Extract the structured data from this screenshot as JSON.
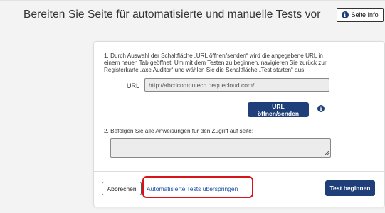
{
  "page": {
    "title": "Bereiten Sie Seite für automatisierte und manuelle Tests vor",
    "info_button_label": "Seite Info"
  },
  "dialog": {
    "step1_text": "1. Durch Auswahl der Schaltfläche „URL öffnen/senden“ wird die angegebene URL in einem neuen Tab geöffnet. Um mit dem Testen zu beginnen, navigieren Sie zurück zur Registerkarte „axe Auditor“ und wählen Sie die Schaltfläche „Test starten“ aus:",
    "url_label": "URL",
    "url_value": "http://abcdcomputech.dequecloud.com/",
    "open_button_label": "URL öffnen/senden",
    "step2_text": "2. Befolgen Sie alle Anweisungen für den Zugriff auf seite:",
    "instructions_value": "",
    "cancel_label": "Abbrechen",
    "skip_link_label": "Automatisierte Tests überspringen",
    "begin_label": "Test beginnen"
  },
  "icons": {
    "info": "info-icon"
  },
  "colors": {
    "primary": "#1e3f7a",
    "highlight": "#d8141a",
    "link": "#1f4f9e"
  }
}
